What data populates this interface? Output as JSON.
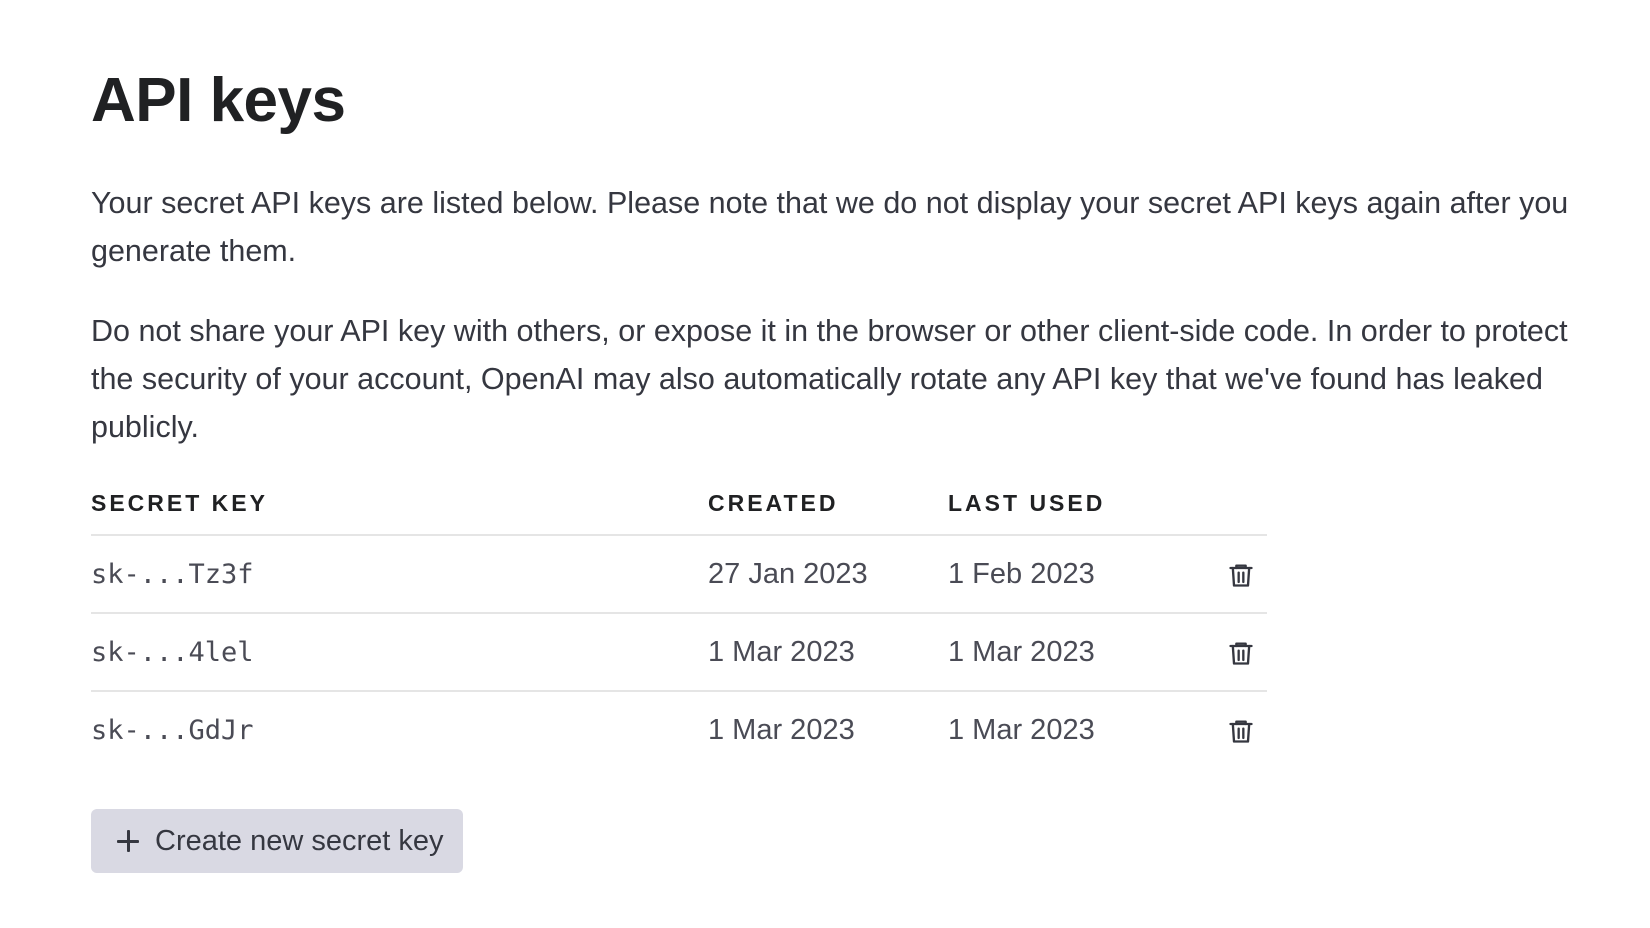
{
  "page": {
    "title": "API keys",
    "description_1": "Your secret API keys are listed below. Please note that we do not display your secret API keys again after you generate them.",
    "description_2": "Do not share your API key with others, or expose it in the browser or other client-side code. In order to protect the security of your account, OpenAI may also automatically rotate any API key that we've found has leaked publicly."
  },
  "table": {
    "headers": {
      "secret_key": "SECRET KEY",
      "created": "CREATED",
      "last_used": "LAST USED"
    },
    "rows": [
      {
        "key": "sk-...Tz3f",
        "created": "27 Jan 2023",
        "last_used": "1 Feb 2023",
        "action_icon": "trash-icon"
      },
      {
        "key": "sk-...4lel",
        "created": "1 Mar 2023",
        "last_used": "1 Mar 2023",
        "action_icon": "trash-icon"
      },
      {
        "key": "sk-...GdJr",
        "created": "1 Mar 2023",
        "last_used": "1 Mar 2023",
        "action_icon": "trash-icon"
      }
    ]
  },
  "create_button": {
    "icon": "plus-icon",
    "label": "Create new secret key"
  },
  "colors": {
    "button_bg": "#d9d9e3",
    "text": "#353740",
    "heading": "#202123",
    "divider": "#e5e5e5"
  }
}
